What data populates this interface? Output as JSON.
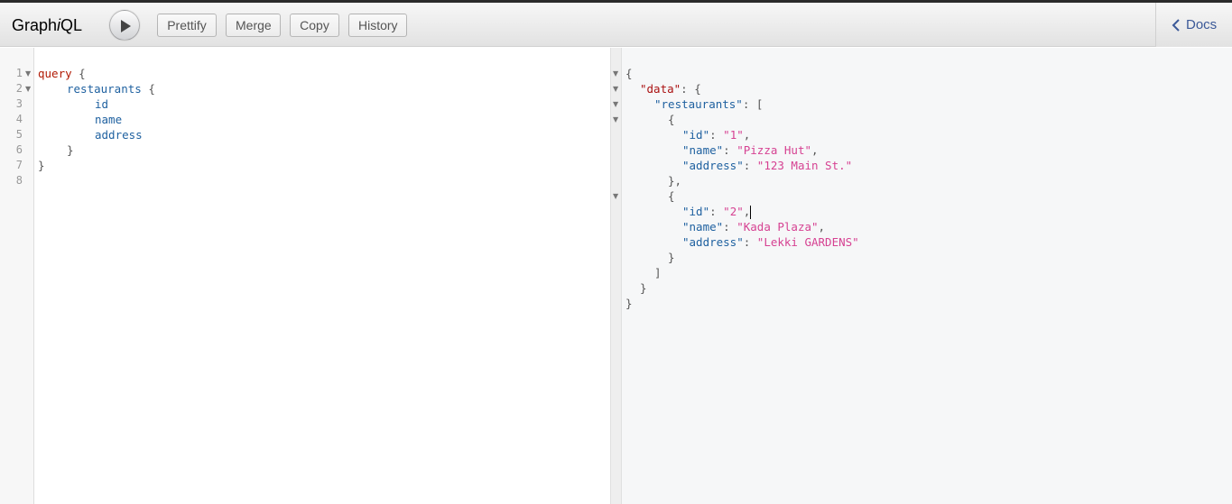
{
  "app": {
    "title_prefix": "Graph",
    "title_italic": "i",
    "title_suffix": "QL"
  },
  "toolbar": {
    "buttons": [
      {
        "label": "Prettify"
      },
      {
        "label": "Merge"
      },
      {
        "label": "Copy"
      },
      {
        "label": "History"
      }
    ],
    "docs_label": "Docs"
  },
  "query_editor": {
    "line_numbers": [
      "1",
      "2",
      "3",
      "4",
      "5",
      "6",
      "7",
      "8"
    ],
    "lines": {
      "l1_kw": "query",
      "l1_brace": " {",
      "l2_field": "restaurants",
      "l2_brace": " {",
      "l3_field": "id",
      "l4_field": "name",
      "l5_field": "address",
      "l6_brace": "}",
      "l7_brace": "}"
    }
  },
  "result": {
    "open": "{",
    "data_key": "\"data\"",
    "restaurants_key": "\"restaurants\"",
    "items": [
      {
        "id_key": "\"id\"",
        "id_val": "\"1\"",
        "name_key": "\"name\"",
        "name_val": "\"Pizza Hut\"",
        "address_key": "\"address\"",
        "address_val": "\"123 Main St.\""
      },
      {
        "id_key": "\"id\"",
        "id_val": "\"2\"",
        "name_key": "\"name\"",
        "name_val": "\"Kada Plaza\"",
        "address_key": "\"address\"",
        "address_val": "\"Lekki GARDENS\""
      }
    ]
  },
  "colors": {
    "keyword": "#b11a04",
    "field": "#1f61a0",
    "json_key": "#a11111",
    "json_string": "#d64292",
    "docs_link": "#3b5998"
  }
}
